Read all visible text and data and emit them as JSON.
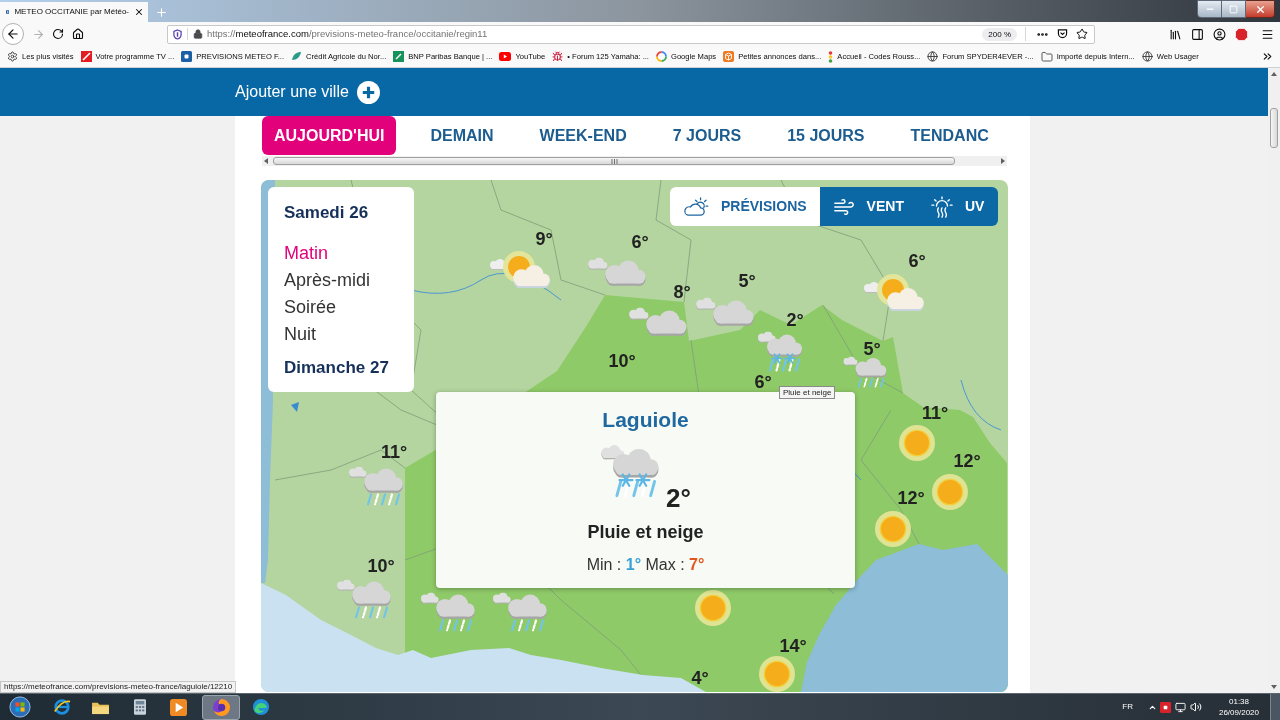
{
  "browser": {
    "tab": {
      "title": "METEO OCCITANIE par Météo-"
    },
    "address": {
      "scheme": "https://",
      "host": "meteofrance.com",
      "path": "/previsions-meteo-france/occitanie/regin11"
    },
    "zoom": "200 %",
    "bookmarks": [
      "Les plus visités",
      "Votre programme TV ...",
      "PREVISIONS METEO F...",
      "Crédit Agricole du Nor...",
      "BNP Paribas Banque | ...",
      "YouTube",
      "• Forum 125 Yamaha: ...",
      "Google Maps",
      "Petites annonces dans...",
      "Accueil - Codes Rouss...",
      "Forum SPYDER4EVER -...",
      "Importé depuis Intern...",
      "Web Usager"
    ]
  },
  "header": {
    "add_city": "Ajouter une ville"
  },
  "tabs": [
    {
      "label": "AUJOURD'HUI",
      "selected": true
    },
    {
      "label": "DEMAIN",
      "selected": false
    },
    {
      "label": "WEEK-END",
      "selected": false
    },
    {
      "label": "7 JOURS",
      "selected": false
    },
    {
      "label": "15 JOURS",
      "selected": false
    },
    {
      "label": "TENDANC",
      "selected": false
    }
  ],
  "map": {
    "days": [
      {
        "label": "Samedi 26",
        "periods": [
          {
            "label": "Matin",
            "selected": true
          },
          {
            "label": "Après-midi",
            "selected": false
          },
          {
            "label": "Soirée",
            "selected": false
          },
          {
            "label": "Nuit",
            "selected": false
          }
        ]
      },
      {
        "label": "Dimanche 27"
      }
    ],
    "layers": [
      {
        "label": "PRÉVISIONS",
        "selected": true
      },
      {
        "label": "VENT",
        "selected": false
      },
      {
        "label": "UV",
        "selected": false
      }
    ],
    "markers": [
      {
        "temp": "9°",
        "kind": "sun_cloud"
      },
      {
        "temp": "6°",
        "kind": "cloud"
      },
      {
        "temp": "6°",
        "kind": "sun_cloud"
      },
      {
        "temp": "5°",
        "kind": "cloud"
      },
      {
        "temp": "8°",
        "kind": "cloud"
      },
      {
        "temp": "2°",
        "kind": "rain_snow"
      },
      {
        "temp": "5°",
        "kind": "rain"
      },
      {
        "temp": "10°"
      },
      {
        "temp": "6°"
      },
      {
        "temp": "11°",
        "kind": "sun"
      },
      {
        "temp": "11°",
        "kind": "rain"
      },
      {
        "temp": "12°",
        "kind": "sun"
      },
      {
        "temp": "12°",
        "kind": "sun"
      },
      {
        "temp": "10°",
        "kind": "rain"
      },
      {
        "kind": "rain"
      },
      {
        "kind": "rain"
      },
      {
        "kind": "sun"
      },
      {
        "temp": "14°",
        "kind": "sun"
      },
      {
        "temp": "4°"
      }
    ],
    "popup": {
      "city": "Laguiole",
      "kind": "rain_snow",
      "temp": "2°",
      "condition": "Pluie et neige",
      "min_label": "Min :",
      "min": "1°",
      "max_label": "Max :",
      "max": "7°"
    },
    "tooltip": "Pluie et neige"
  },
  "status_url": "https://meteofrance.com/previsions-meteo-france/laguiole/12210",
  "taskbar": {
    "language": "FR",
    "time": "01:38",
    "date": "26/09/2020"
  }
}
